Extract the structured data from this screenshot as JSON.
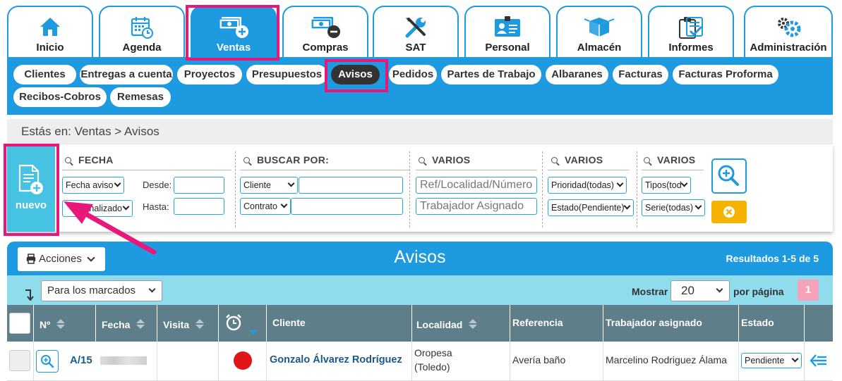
{
  "modules": [
    {
      "label": "Inicio",
      "icon": "home-icon"
    },
    {
      "label": "Agenda",
      "icon": "calendar-icon"
    },
    {
      "label": "Ventas",
      "icon": "money-plus-icon",
      "active": true
    },
    {
      "label": "Compras",
      "icon": "money-minus-icon"
    },
    {
      "label": "SAT",
      "icon": "tools-icon"
    },
    {
      "label": "Personal",
      "icon": "id-card-icon"
    },
    {
      "label": "Almacén",
      "icon": "boxes-icon"
    },
    {
      "label": "Informes",
      "icon": "clipboard-check-icon"
    },
    {
      "label": "Administración",
      "icon": "gears-icon"
    }
  ],
  "submenu": [
    "Clientes",
    "Entregas a cuenta",
    "Proyectos",
    "Presupuestos",
    "Avisos",
    "Pedidos",
    "Partes de Trabajo",
    "Albaranes",
    "Facturas",
    "Facturas Proforma",
    "Recibos-Cobros",
    "Remesas"
  ],
  "submenu_active": "Avisos",
  "breadcrumb": "Estás en: Ventas > Avisos",
  "nuevo_label": "nuevo",
  "filters": {
    "fecha": {
      "heading": "FECHA",
      "date_type": "Fecha aviso",
      "status": "Finalizado",
      "desde_label": "Desde:",
      "hasta_label": "Hasta:"
    },
    "buscar": {
      "heading": "BUSCAR POR:",
      "field1": "Cliente",
      "field2": "Contrato"
    },
    "varios1": {
      "heading": "VARIOS",
      "ref_placeholder": "Ref/Localidad/Número",
      "trabajador_placeholder": "Trabajador Asignado"
    },
    "varios2": {
      "heading": "VARIOS",
      "prioridad": "Prioridad(todas)",
      "estado": "Estado(Pendiente)"
    },
    "varios3": {
      "heading": "VARIOS",
      "tipos": "Tipos(tod",
      "serie": "Serie(todas)"
    }
  },
  "results": {
    "acciones_label": "Acciones",
    "title": "Avisos",
    "count": "Resultados 1-5 de 5",
    "bulk_select": "Para los marcados",
    "mostrar_label": "Mostrar",
    "per_page": "20",
    "por_pagina_label": "por página",
    "page": "1"
  },
  "columns": [
    "Nº",
    "Fecha",
    "Visita",
    "Cliente",
    "Localidad",
    "Referencia",
    "Trabajador asignado",
    "Estado"
  ],
  "row": {
    "numero": "A/15",
    "cliente": "Gonzalo Álvarez Rodríguez",
    "localidad_1": "Oropesa",
    "localidad_2": "(Toledo)",
    "referencia": "Avería baño",
    "trabajador": "Marcelino Rodriguez Álama",
    "estado": "Pendiente",
    "priority_color": "#e0161b"
  },
  "colors": {
    "primary_blue": "#1e9be0",
    "nuevo_cyan": "#46c3e3",
    "highlight_pink": "#e8187a",
    "toolbar_cyan": "#8fdcec",
    "header_slate": "#5e7e8a",
    "clear_yellow": "#f5b300"
  }
}
